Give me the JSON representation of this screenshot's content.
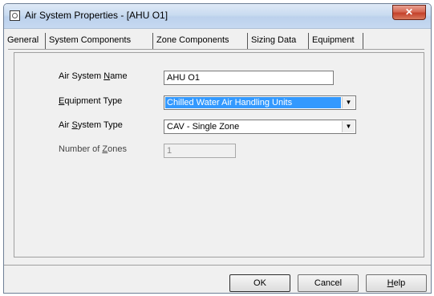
{
  "window": {
    "title": "Air System Properties - [AHU O1]",
    "close_glyph": "✕"
  },
  "tabs": [
    {
      "label": "General",
      "active": true
    },
    {
      "label": "System Components",
      "active": false
    },
    {
      "label": "Zone Components",
      "active": false
    },
    {
      "label": "Sizing Data",
      "active": false
    },
    {
      "label": "Equipment",
      "active": false
    }
  ],
  "form": {
    "name_label_pre": "Air System ",
    "name_label_key": "N",
    "name_label_post": "ame",
    "name_value": "AHU O1",
    "equipment_label_pre": "",
    "equipment_label_key": "E",
    "equipment_label_post": "quipment Type",
    "equipment_value": "Chilled Water Air Handling Units",
    "systype_label_pre": "Air ",
    "systype_label_key": "S",
    "systype_label_post": "ystem Type",
    "systype_value": "CAV - Single Zone",
    "zones_label_pre": "Number of ",
    "zones_label_key": "Z",
    "zones_label_post": "ones",
    "zones_value": "1"
  },
  "buttons": {
    "ok": "OK",
    "cancel": "Cancel",
    "help_key": "H",
    "help_post": "elp"
  },
  "icons": {
    "dropdown": "▼"
  }
}
